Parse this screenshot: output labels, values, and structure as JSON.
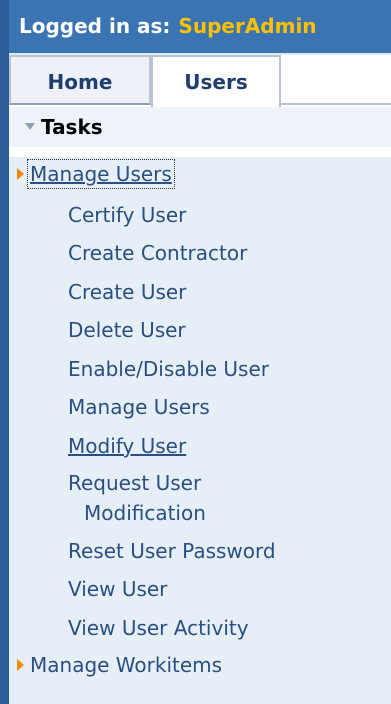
{
  "header": {
    "logged_in_label": "Logged in as:",
    "username": "SuperAdmin"
  },
  "tabs": [
    {
      "label": "Home"
    },
    {
      "label": "Users"
    }
  ],
  "tasks": {
    "title": "Tasks",
    "groups": [
      {
        "label": "Manage Users",
        "items": [
          {
            "label": "Certify User"
          },
          {
            "label": "Create Contractor"
          },
          {
            "label": "Create User"
          },
          {
            "label": "Delete User"
          },
          {
            "label": "Enable/Disable User"
          },
          {
            "label": "Manage Users"
          },
          {
            "label": "Modify User"
          },
          {
            "label": "Request User"
          },
          {
            "label": "Reset User Password"
          },
          {
            "label": "View User"
          },
          {
            "label": "View User Activity"
          }
        ],
        "item_request_second_line": "Modification"
      },
      {
        "label": "Manage Workitems",
        "items": []
      }
    ]
  },
  "colors": {
    "header_bg": "#3a74b3",
    "username": "#ffc000",
    "link": "#2a4f82",
    "expand_arrow": "#f08a00",
    "panel_bg": "#e6eef8"
  }
}
